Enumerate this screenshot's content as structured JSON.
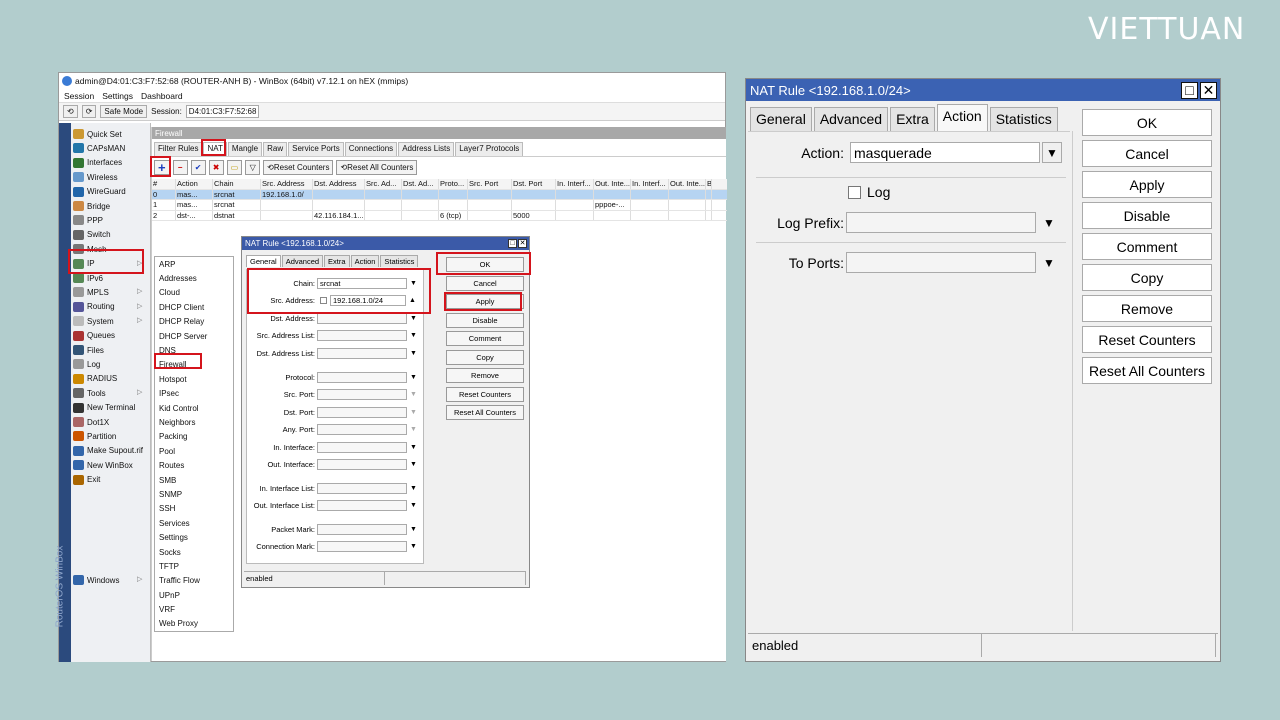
{
  "brand": {
    "logo": "VIETTUAN"
  },
  "winbox": {
    "title": "admin@D4:01:C3:F7:52:68 (ROUTER-ANH B) - WinBox (64bit) v7.12.1 on hEX (mmips)",
    "menu": [
      "Session",
      "Settings",
      "Dashboard"
    ],
    "safe_mode": "Safe Mode",
    "session_label": "Session:",
    "session_value": "D4:01:C3:F7:52:68",
    "nav": [
      "Quick Set",
      "CAPsMAN",
      "Interfaces",
      "Wireless",
      "WireGuard",
      "Bridge",
      "PPP",
      "Switch",
      "Mesh",
      "IP",
      "IPv6",
      "MPLS",
      "Routing",
      "System",
      "Queues",
      "Files",
      "Log",
      "RADIUS",
      "Tools",
      "New Terminal",
      "Dot1X",
      "Partition",
      "Make Supout.rif",
      "New WinBox",
      "Exit",
      "Windows"
    ],
    "strip_text": "RouterOS WinBox",
    "submenu": [
      "ARP",
      "Addresses",
      "Cloud",
      "DHCP Client",
      "DHCP Relay",
      "DHCP Server",
      "DNS",
      "Firewall",
      "Hotspot",
      "IPsec",
      "Kid Control",
      "Neighbors",
      "Packing",
      "Pool",
      "Routes",
      "SMB",
      "SNMP",
      "SSH",
      "Services",
      "Settings",
      "Socks",
      "TFTP",
      "Traffic Flow",
      "UPnP",
      "VRF",
      "Web Proxy"
    ],
    "firewall_title": "Firewall",
    "fw_tabs": [
      "Filter Rules",
      "NAT",
      "Mangle",
      "Raw",
      "Service Ports",
      "Connections",
      "Address Lists",
      "Layer7 Protocols"
    ],
    "reset_counters": "Reset Counters",
    "reset_all": "Reset All Counters",
    "columns": [
      "#",
      "Action",
      "Chain",
      "Src. Address",
      "Dst. Address",
      "Src. Ad...",
      "Dst. Ad...",
      "Proto...",
      "Src. Port",
      "Dst. Port",
      "In. Interf...",
      "Out. Inte...",
      "In. Interf...",
      "Out. Inte...",
      "B"
    ],
    "rows": [
      [
        "0",
        "mas...",
        "srcnat",
        "192.168.1.0/",
        "",
        "",
        "",
        "",
        "",
        "",
        "",
        "",
        "",
        "",
        ""
      ],
      [
        "1",
        "mas...",
        "srcnat",
        "",
        "",
        "",
        "",
        "",
        "",
        "",
        "",
        "pppoe-...",
        "",
        "",
        ""
      ],
      [
        "2",
        "dst-...",
        "dstnat",
        "",
        "42.116.184.1...",
        "",
        "",
        "6 (tcp)",
        "",
        "5000",
        "",
        "",
        "",
        "",
        ""
      ]
    ]
  },
  "small_dialog": {
    "title": "NAT Rule <192.168.1.0/24>",
    "tabs": [
      "General",
      "Advanced",
      "Extra",
      "Action",
      "Statistics"
    ],
    "fields": [
      {
        "label": "Chain:",
        "value": "srcnat"
      },
      {
        "label": "Src. Address:",
        "value": "192.168.1.0/24"
      },
      {
        "label": "Dst. Address:",
        "value": ""
      },
      {
        "label": "Src. Address List:",
        "value": ""
      },
      {
        "label": "Dst. Address List:",
        "value": ""
      },
      {
        "label": "Protocol:",
        "value": ""
      },
      {
        "label": "Src. Port:",
        "value": ""
      },
      {
        "label": "Dst. Port:",
        "value": ""
      },
      {
        "label": "Any. Port:",
        "value": ""
      },
      {
        "label": "In. Interface:",
        "value": ""
      },
      {
        "label": "Out. Interface:",
        "value": ""
      },
      {
        "label": "In. Interface List:",
        "value": ""
      },
      {
        "label": "Out. Interface List:",
        "value": ""
      },
      {
        "label": "Packet Mark:",
        "value": ""
      },
      {
        "label": "Connection Mark:",
        "value": ""
      }
    ],
    "buttons": [
      "OK",
      "Cancel",
      "Apply",
      "Disable",
      "Comment",
      "Copy",
      "Remove",
      "Reset Counters",
      "Reset All Counters"
    ],
    "status": "enabled"
  },
  "big_dialog": {
    "title": "NAT Rule <192.168.1.0/24>",
    "tabs": [
      "General",
      "Advanced",
      "Extra",
      "Action",
      "Statistics"
    ],
    "action_label": "Action:",
    "action_value": "masquerade",
    "log_label": "Log",
    "log_prefix_label": "Log Prefix:",
    "to_ports_label": "To Ports:",
    "buttons": [
      "OK",
      "Cancel",
      "Apply",
      "Disable",
      "Comment",
      "Copy",
      "Remove",
      "Reset Counters",
      "Reset All Counters"
    ],
    "status": "enabled"
  }
}
